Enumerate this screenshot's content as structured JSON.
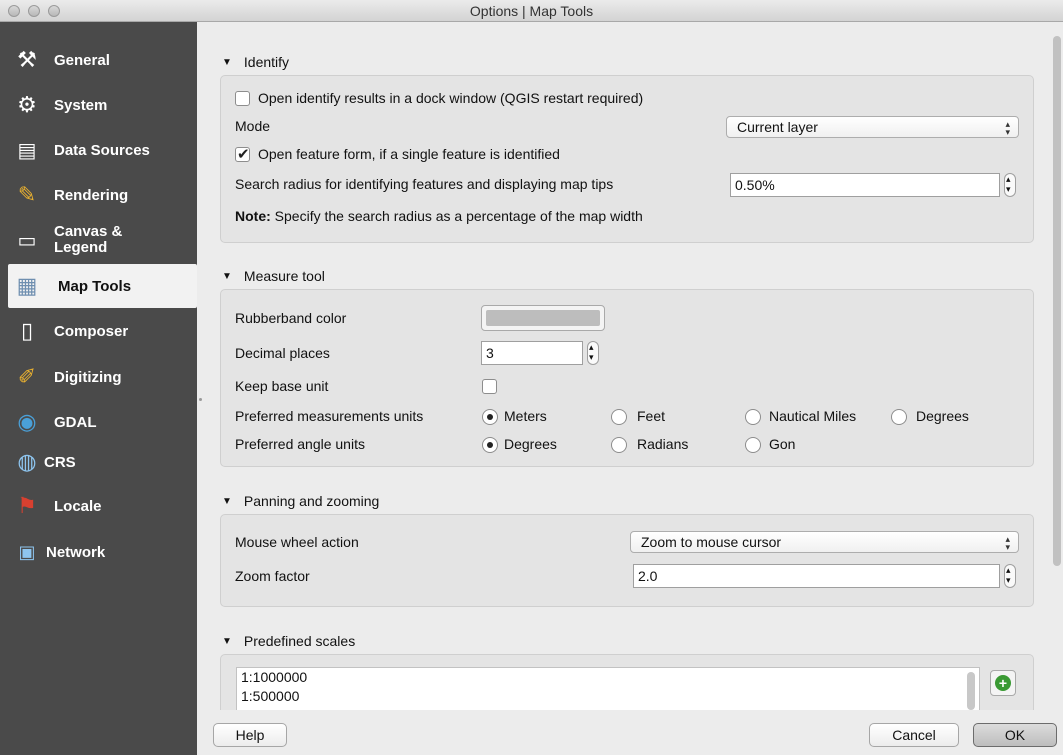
{
  "window": {
    "title": "Options | Map Tools"
  },
  "sidebar": {
    "items": [
      {
        "label": "General",
        "icon": "tools-icon"
      },
      {
        "label": "System",
        "icon": "gears-icon"
      },
      {
        "label": "Data Sources",
        "icon": "table-icon"
      },
      {
        "label": "Rendering",
        "icon": "brush-icon"
      },
      {
        "label": "Canvas & Legend",
        "icon": "canvas-icon"
      },
      {
        "label": "Map Tools",
        "icon": "map-tools-icon"
      },
      {
        "label": "Composer",
        "icon": "composer-icon"
      },
      {
        "label": "Digitizing",
        "icon": "digitizing-icon"
      },
      {
        "label": "GDAL",
        "icon": "gdal-icon"
      },
      {
        "label": "CRS",
        "icon": "globe-icon"
      },
      {
        "label": "Locale",
        "icon": "flag-icon"
      },
      {
        "label": "Network",
        "icon": "network-icon"
      }
    ],
    "active": "Map Tools"
  },
  "identify": {
    "title": "Identify",
    "dock_label": "Open identify results in a dock window (QGIS restart required)",
    "dock_checked": false,
    "mode_label": "Mode",
    "mode_value": "Current layer",
    "feature_form_label": "Open feature form, if a single feature is identified",
    "feature_form_checked": true,
    "radius_label": "Search radius for identifying features and displaying map tips",
    "radius_value": "0.50%",
    "note_bold": "Note:",
    "note_text": " Specify the search radius as a percentage of the map width"
  },
  "measure": {
    "title": "Measure tool",
    "rubberband_label": "Rubberband color",
    "rubberband_color": "#bdbdbd",
    "decimal_label": "Decimal places",
    "decimal_value": "3",
    "keep_base_label": "Keep base unit",
    "keep_base_checked": false,
    "units_label": "Preferred measurements units",
    "units_options": [
      "Meters",
      "Feet",
      "Nautical Miles",
      "Degrees"
    ],
    "units_selected": "Meters",
    "angle_label": "Preferred angle units",
    "angle_options": [
      "Degrees",
      "Radians",
      "Gon"
    ],
    "angle_selected": "Degrees"
  },
  "panning": {
    "title": "Panning and zooming",
    "wheel_label": "Mouse wheel action",
    "wheel_value": "Zoom to mouse cursor",
    "zoom_label": "Zoom factor",
    "zoom_value": "2.0"
  },
  "scales": {
    "title": "Predefined scales",
    "items": [
      "1:1000000",
      "1:500000"
    ]
  },
  "buttons": {
    "help": "Help",
    "cancel": "Cancel",
    "ok": "OK"
  }
}
